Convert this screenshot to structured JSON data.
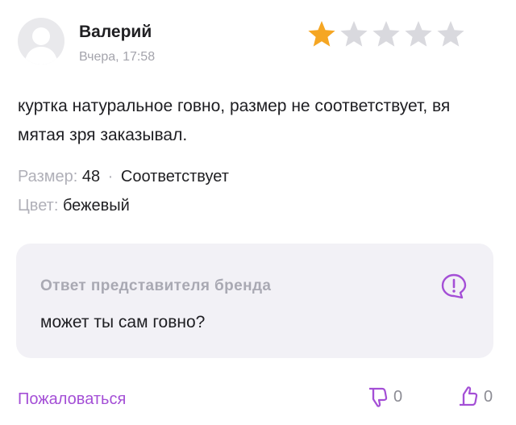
{
  "review": {
    "author": "Валерий",
    "date": "Вчера, 17:58",
    "rating": 1,
    "rating_max": 5,
    "text": "куртка натуральное говно, размер не соответствует, вя мятая зря заказывал.",
    "size_label": "Размер:",
    "size_value": "48",
    "fit_value": "Соответствует",
    "color_label": "Цвет:",
    "color_value": "бежевый"
  },
  "brand_reply": {
    "title": "Ответ представителя бренда",
    "text": "может ты сам говно?",
    "icon": "alert-icon"
  },
  "actions": {
    "complain_label": "Пожаловаться",
    "dislike_count": "0",
    "like_count": "0",
    "dislike_icon": "thumbs-down-icon",
    "like_icon": "thumbs-up-icon"
  },
  "colors": {
    "accent": "#a44fd6",
    "star_filled": "#f5a623",
    "star_empty": "#d9d9de",
    "muted": "#a4a4ac",
    "reply_bg": "#f2f1f6"
  }
}
